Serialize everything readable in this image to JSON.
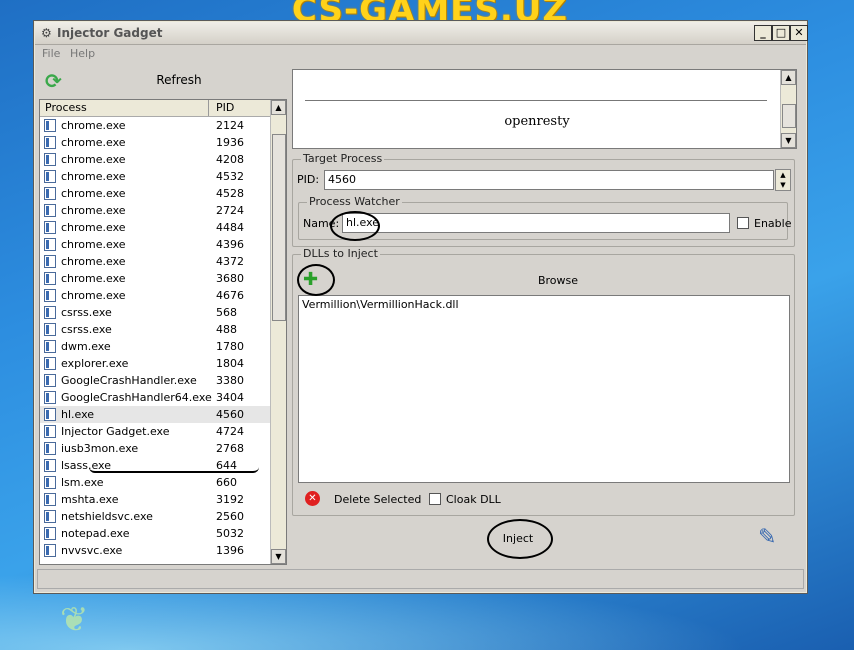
{
  "watermark": "CS-GAMES.UZ",
  "window": {
    "title": "Injector Gadget",
    "minimize": "_",
    "maximize": "□",
    "close": "✕"
  },
  "menu": {
    "file": "File",
    "help": "Help"
  },
  "left": {
    "refresh_label": "Refresh",
    "columns": {
      "process": "Process",
      "pid": "PID"
    },
    "rows": [
      {
        "name": "chrome.exe",
        "pid": "2124"
      },
      {
        "name": "chrome.exe",
        "pid": "1936"
      },
      {
        "name": "chrome.exe",
        "pid": "4208"
      },
      {
        "name": "chrome.exe",
        "pid": "4532"
      },
      {
        "name": "chrome.exe",
        "pid": "4528"
      },
      {
        "name": "chrome.exe",
        "pid": "2724"
      },
      {
        "name": "chrome.exe",
        "pid": "4484"
      },
      {
        "name": "chrome.exe",
        "pid": "4396"
      },
      {
        "name": "chrome.exe",
        "pid": "4372"
      },
      {
        "name": "chrome.exe",
        "pid": "3680"
      },
      {
        "name": "chrome.exe",
        "pid": "4676"
      },
      {
        "name": "csrss.exe",
        "pid": "568"
      },
      {
        "name": "csrss.exe",
        "pid": "488"
      },
      {
        "name": "dwm.exe",
        "pid": "1780"
      },
      {
        "name": "explorer.exe",
        "pid": "1804"
      },
      {
        "name": "GoogleCrashHandler.exe",
        "pid": "3380"
      },
      {
        "name": "GoogleCrashHandler64.exe",
        "pid": "3404"
      },
      {
        "name": "hl.exe",
        "pid": "4560"
      },
      {
        "name": "Injector Gadget.exe",
        "pid": "4724"
      },
      {
        "name": "iusb3mon.exe",
        "pid": "2768"
      },
      {
        "name": "lsass.exe",
        "pid": "644"
      },
      {
        "name": "lsm.exe",
        "pid": "660"
      },
      {
        "name": "mshta.exe",
        "pid": "3192"
      },
      {
        "name": "netshieldsvc.exe",
        "pid": "2560"
      },
      {
        "name": "notepad.exe",
        "pid": "5032"
      },
      {
        "name": "nvvsvc.exe",
        "pid": "1396"
      }
    ],
    "selected_index": 17
  },
  "preview": {
    "text": "openresty"
  },
  "target": {
    "group_label": "Target Process",
    "pid_label": "PID:",
    "pid_value": "4560",
    "watcher": {
      "group_label": "Process Watcher",
      "name_label": "Name:",
      "name_value": "hl.exe",
      "enable_label": "Enable"
    }
  },
  "dlls": {
    "group_label": "DLLs to Inject",
    "browse_label": "Browse",
    "items": [
      "Vermillion\\VermillionHack.dll"
    ],
    "delete_label": "Delete Selected",
    "cloak_label": "Cloak DLL"
  },
  "inject_label": "Inject"
}
